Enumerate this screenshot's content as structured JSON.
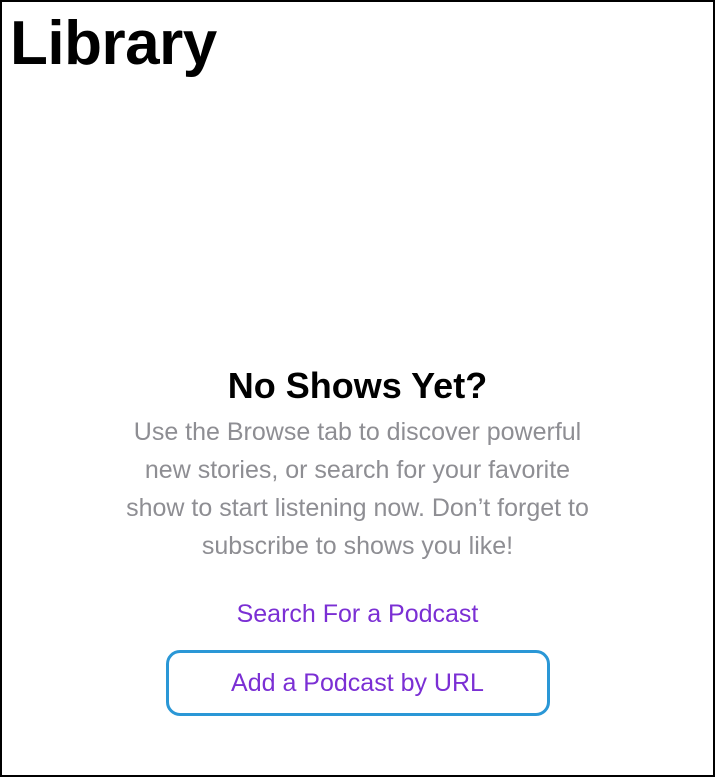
{
  "header": {
    "title": "Library"
  },
  "empty_state": {
    "title": "No Shows Yet?",
    "body_lines": [
      "Use the Browse tab to discover powerful",
      "new stories, or search for your favorite",
      "show to start listening now. Don’t forget to",
      "subscribe to shows you like!"
    ]
  },
  "actions": {
    "search_label": "Search For a Podcast",
    "add_by_url_label": "Add a Podcast by URL"
  },
  "colors": {
    "link": "#7b2fd4",
    "body_text": "#8e8e93",
    "highlight_ring": "#2a97d6",
    "title": "#000000"
  }
}
